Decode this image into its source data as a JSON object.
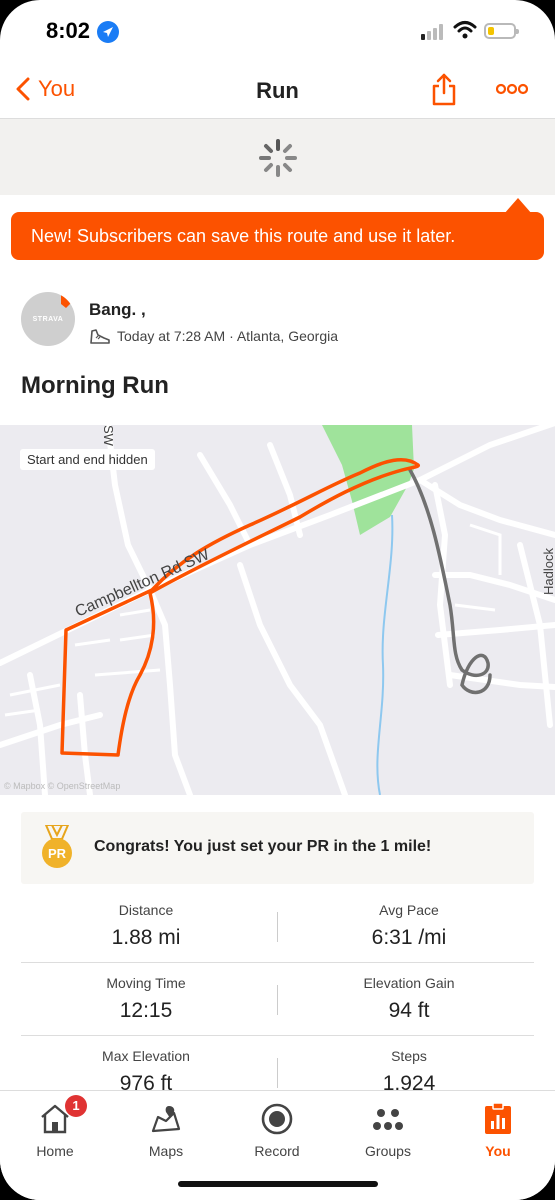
{
  "status_bar": {
    "time": "8:02"
  },
  "nav": {
    "back_label": "You",
    "title": "Run"
  },
  "tooltip": {
    "text": "New! Subscribers can save this route and use it later."
  },
  "athlete": {
    "avatar_text": "STRAVA",
    "name": "Bang. ,",
    "meta": "Today at 7:28 AM · Atlanta, Georgia"
  },
  "activity": {
    "title": "Morning Run"
  },
  "map": {
    "privacy_label": "Start and end hidden",
    "street_label": "Campbellton Rd SW",
    "street_label_2": "Hadlock",
    "street_label_3": "SW",
    "attribution": "© Mapbox © OpenStreetMap",
    "route_color": "#fc5200",
    "hidden_route_color": "#707070"
  },
  "pr": {
    "icon_text": "PR",
    "message": "Congrats! You just set your PR in the 1 mile!"
  },
  "stats": [
    {
      "left_label": "Distance",
      "left_value": "1.88 mi",
      "right_label": "Avg Pace",
      "right_value": "6:31 /mi"
    },
    {
      "left_label": "Moving Time",
      "left_value": "12:15",
      "right_label": "Elevation Gain",
      "right_value": "94 ft"
    },
    {
      "left_label": "Max Elevation",
      "left_value": "976 ft",
      "right_label": "Steps",
      "right_value": "1,924"
    }
  ],
  "tabbar": {
    "items": [
      {
        "label": "Home",
        "icon": "home-icon",
        "badge": "1"
      },
      {
        "label": "Maps",
        "icon": "maps-icon"
      },
      {
        "label": "Record",
        "icon": "record-icon"
      },
      {
        "label": "Groups",
        "icon": "groups-icon"
      },
      {
        "label": "You",
        "icon": "you-icon",
        "active": true
      }
    ]
  },
  "colors": {
    "accent": "#fc5200",
    "badge": "#e03333"
  }
}
